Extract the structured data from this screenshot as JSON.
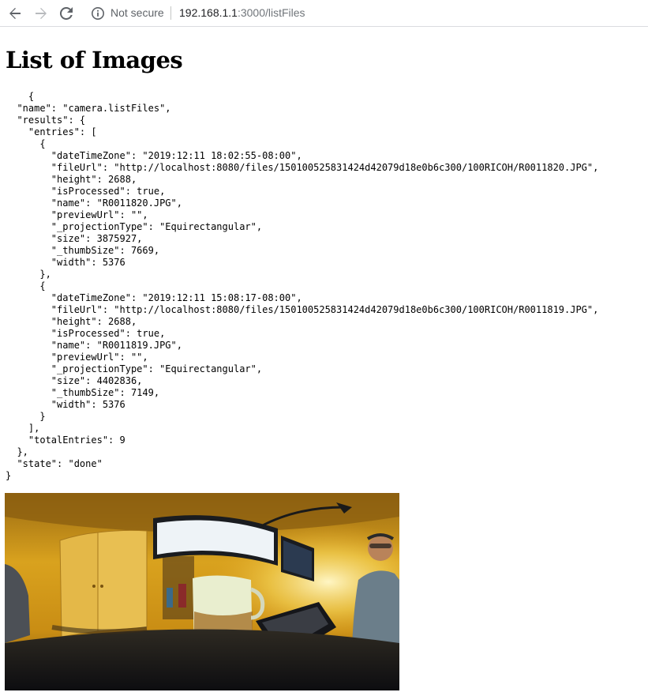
{
  "browser": {
    "not_secure_label": "Not secure",
    "url_host": "192.168.1.1",
    "url_path": ":3000/listFiles"
  },
  "page": {
    "heading": "List of Images",
    "json_text": "    {\n  \"name\": \"camera.listFiles\",\n  \"results\": {\n    \"entries\": [\n      {\n        \"dateTimeZone\": \"2019:12:11 18:02:55-08:00\",\n        \"fileUrl\": \"http://localhost:8080/files/150100525831424d42079d18e0b6c300/100RICOH/R0011820.JPG\",\n        \"height\": 2688,\n        \"isProcessed\": true,\n        \"name\": \"R0011820.JPG\",\n        \"previewUrl\": \"\",\n        \"_projectionType\": \"Equirectangular\",\n        \"size\": 3875927,\n        \"_thumbSize\": 7669,\n        \"width\": 5376\n      },\n      {\n        \"dateTimeZone\": \"2019:12:11 15:08:17-08:00\",\n        \"fileUrl\": \"http://localhost:8080/files/150100525831424d42079d18e0b6c300/100RICOH/R0011819.JPG\",\n        \"height\": 2688,\n        \"isProcessed\": true,\n        \"name\": \"R0011819.JPG\",\n        \"previewUrl\": \"\",\n        \"_projectionType\": \"Equirectangular\",\n        \"size\": 4402836,\n        \"_thumbSize\": 7149,\n        \"width\": 5376\n      }\n    ],\n    \"totalEntries\": 9\n  },\n  \"state\": \"done\"\n}"
  },
  "icons": {
    "back": "back-arrow-icon",
    "forward": "forward-arrow-icon",
    "reload": "reload-icon",
    "info": "info-icon"
  }
}
